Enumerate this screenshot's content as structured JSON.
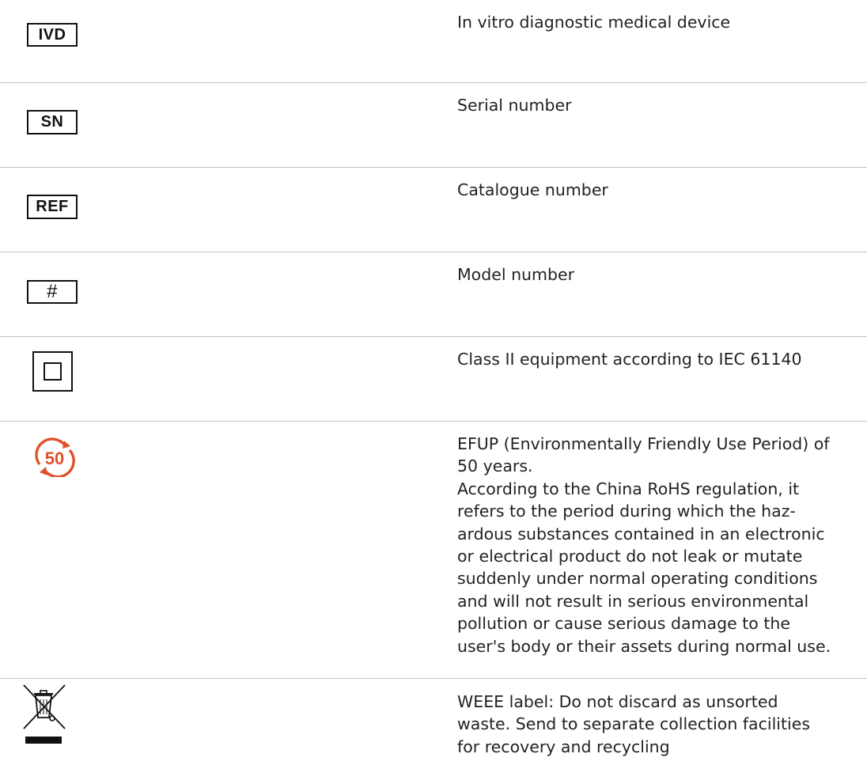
{
  "rows": [
    {
      "symbol_text": "IVD",
      "description_lines": [
        "In vitro diagnostic medical device"
      ]
    },
    {
      "symbol_text": "SN",
      "description_lines": [
        "Serial number"
      ]
    },
    {
      "symbol_text": "REF",
      "description_lines": [
        "Catalogue number"
      ]
    },
    {
      "symbol_text": "#",
      "description_lines": [
        "Model number"
      ]
    },
    {
      "symbol_icon": "double-square-class-ii-icon",
      "description_lines": [
        "Class II equipment according to IEC 61140"
      ]
    },
    {
      "symbol_icon": "efup-50-icon",
      "symbol_text": "50",
      "symbol_color": "#e0502a",
      "description_lines": [
        "EFUP (Environmentally Friendly Use Period) of",
        "50 years.",
        "According to the China RoHS regulation, it",
        "refers to the period during which the haz-",
        "ardous substances contained in an electronic",
        "or electrical product do not leak or mutate",
        "suddenly under normal operating conditions",
        "and will not result in serious environmental",
        "pollution or cause serious damage to the",
        "user's body or their assets during normal use."
      ]
    },
    {
      "symbol_icon": "weee-crossed-bin-icon",
      "description_lines": [
        "WEEE label: Do not discard as unsorted",
        "waste. Send to separate collection facilities",
        "for recovery and recycling"
      ]
    }
  ]
}
